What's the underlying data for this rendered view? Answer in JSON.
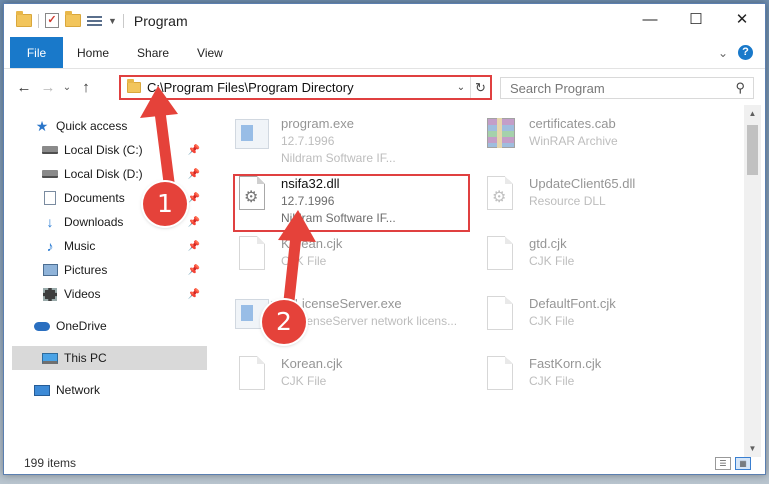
{
  "window": {
    "title": "Program",
    "controls": {
      "minimize": "—",
      "maximize": "☐",
      "close": "✕"
    }
  },
  "ribbon": {
    "tabs": [
      "File",
      "Home",
      "Share",
      "View"
    ],
    "help": "?"
  },
  "address": {
    "path": "C:\\Program Files\\Program Directory",
    "search_placeholder": "Search Program"
  },
  "sidebar": {
    "items": [
      {
        "label": "Quick access",
        "icon": "star-icon"
      },
      {
        "label": "Local Disk (C:)",
        "icon": "disk-icon",
        "pinned": true
      },
      {
        "label": "Local Disk (D:)",
        "icon": "disk-icon",
        "pinned": true
      },
      {
        "label": "Documents",
        "icon": "document-icon",
        "pinned": true
      },
      {
        "label": "Downloads",
        "icon": "download-icon",
        "pinned": true
      },
      {
        "label": "Music",
        "icon": "music-icon",
        "pinned": true
      },
      {
        "label": "Pictures",
        "icon": "pictures-icon",
        "pinned": true
      },
      {
        "label": "Videos",
        "icon": "videos-icon",
        "pinned": true
      },
      {
        "label": "OneDrive",
        "icon": "onedrive-icon"
      },
      {
        "label": "This PC",
        "icon": "computer-icon",
        "selected": true
      },
      {
        "label": "Network",
        "icon": "network-icon"
      }
    ]
  },
  "files": [
    {
      "name": "program.exe",
      "line2": "12.7.1996",
      "line3": "Nildram Software IF...",
      "icon": "exe-icon"
    },
    {
      "name": "certificates.cab",
      "line2": "WinRAR Archive",
      "line3": "",
      "icon": "archive-icon"
    },
    {
      "name": "nsifa32.dll",
      "line2": "12.7.1996",
      "line3": "Nildram Software IF...",
      "icon": "dll-icon",
      "highlighted": true
    },
    {
      "name": "UpdateClient65.dll",
      "line2": "Resource DLL",
      "line3": "",
      "icon": "dll-icon"
    },
    {
      "name": "Korean.cjk",
      "line2": "CJK File",
      "line3": "",
      "icon": "file-icon"
    },
    {
      "name": "gtd.cjk",
      "line2": "CJK File",
      "line3": "",
      "icon": "file-icon"
    },
    {
      "name": "NetworkLicenseServer.exe",
      "line2": "NetworkLicenseServer network licens...",
      "line3": "",
      "icon": "exe-icon"
    },
    {
      "name": "DefaultFont.cjk",
      "line2": "CJK File",
      "line3": "",
      "icon": "file-icon"
    },
    {
      "name": "Korean.cjk",
      "line2": "CJK File",
      "line3": "",
      "icon": "file-icon"
    },
    {
      "name": "FastKorn.cjk",
      "line2": "CJK File",
      "line3": "",
      "icon": "file-icon"
    }
  ],
  "status": {
    "item_count": "199 items"
  },
  "callouts": {
    "step1": "1",
    "step2": "2"
  },
  "colors": {
    "accent": "#1979ca",
    "callout": "#e5423a"
  }
}
